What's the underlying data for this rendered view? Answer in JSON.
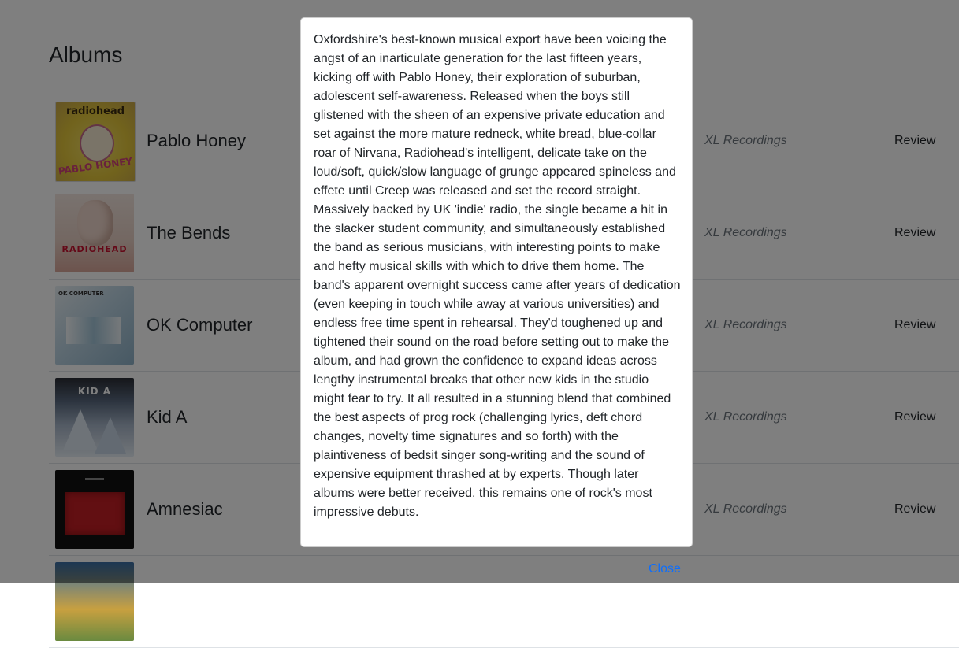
{
  "page": {
    "title": "Albums"
  },
  "albums": [
    {
      "name": "Pablo Honey",
      "label": "XL Recordings",
      "review": "Review",
      "cover_text": "radiohead",
      "cover_sub": "PABLO HONEY",
      "cover_bg": "#e8d24a"
    },
    {
      "name": "The Bends",
      "label": "XL Recordings",
      "review": "Review",
      "cover_text": "RADIOHEAD",
      "cover_bg": "#e9d3c8"
    },
    {
      "name": "OK Computer",
      "label": "XL Recordings",
      "review": "Review",
      "cover_text": "OK COMPUTER",
      "cover_bg": "#bcd4e3"
    },
    {
      "name": "Kid A",
      "label": "XL Recordings",
      "review": "Review",
      "cover_text": "KID A",
      "cover_bg": "#8ea0b8"
    },
    {
      "name": "Amnesiac",
      "label": "XL Recordings",
      "review": "Review",
      "cover_text": "",
      "cover_bg": "#111111"
    }
  ],
  "modal": {
    "body": "Oxfordshire's best-known musical export have been voicing the angst of an inarticulate generation for the last fifteen years, kicking off with Pablo Honey, their exploration of suburban, adolescent self-awareness. Released when the boys still glistened with the sheen of an expensive private education and set against the more mature redneck, white bread, blue-collar roar of Nirvana, Radiohead's intelligent, delicate take on the loud/soft, quick/slow language of grunge appeared spineless and effete until Creep was released and set the record straight. Massively backed by UK 'indie' radio, the single became a hit in the slacker student community, and simultaneously established the band as serious musicians, with interesting points to make and hefty musical skills with which to drive them home. The band's apparent overnight success came after years of dedication (even keeping in touch while away at various universities) and endless free time spent in rehearsal. They'd toughened up and tightened their sound on the road before setting out to make the album, and had grown the confidence to expand ideas across lengthy instrumental breaks that other new kids in the studio might fear to try. It all resulted in a stunning blend that combined the best aspects of prog rock (challenging lyrics, deft chord changes, novelty time signatures and so forth) with the plaintiveness of bedsit singer song-writing and the sound of expensive equipment thrashed at by experts. Though later albums were better received, this remains one of rock's most impressive debuts.",
    "close_label": "Close"
  },
  "colors": {
    "link": "#0d6efd",
    "backdrop": "rgba(0,0,0,0.5)"
  }
}
